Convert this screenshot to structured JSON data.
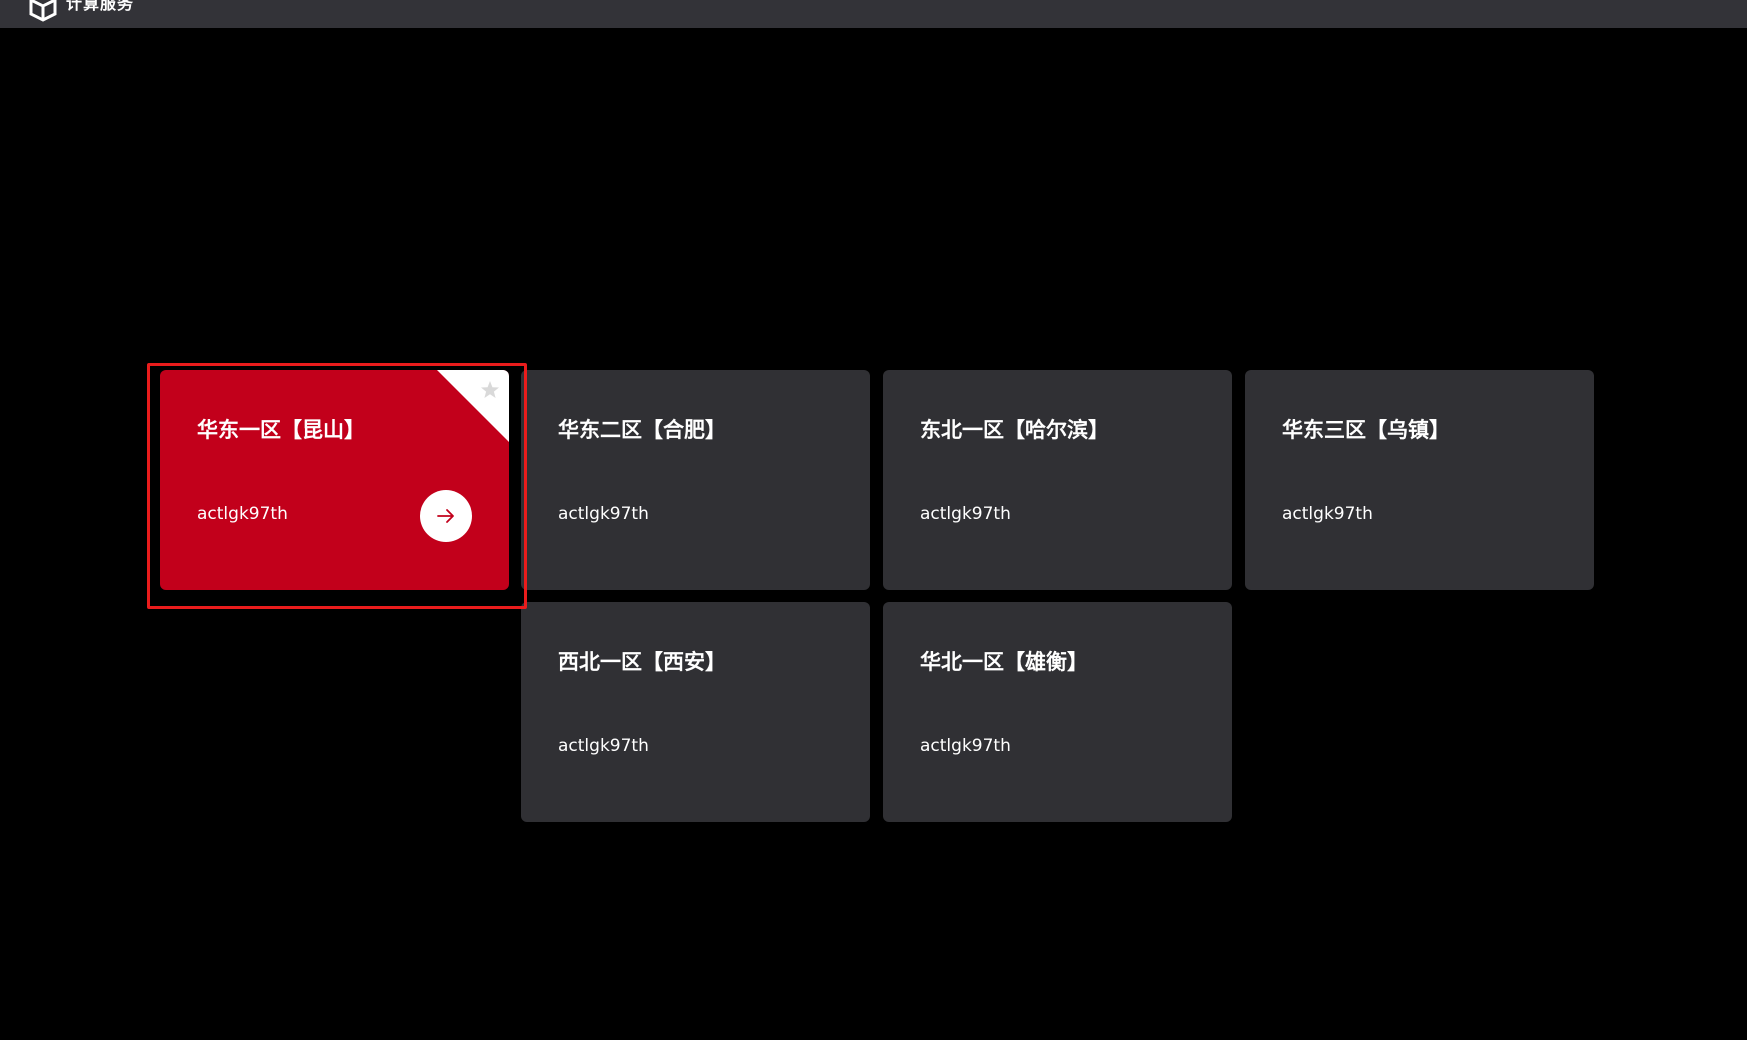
{
  "header": {
    "app_title": "计算服务",
    "logo_icon": "cube-logo-icon"
  },
  "regions": [
    {
      "name": "华东一区【昆山】",
      "account": "actlgk97th",
      "selected": true
    },
    {
      "name": "华东二区【合肥】",
      "account": "actlgk97th",
      "selected": false
    },
    {
      "name": "东北一区【哈尔滨】",
      "account": "actlgk97th",
      "selected": false
    },
    {
      "name": "华东三区【乌镇】",
      "account": "actlgk97th",
      "selected": false
    },
    {
      "name": "西北一区【西安】",
      "account": "actlgk97th",
      "selected": false
    },
    {
      "name": "华北一区【雄衡】",
      "account": "actlgk97th",
      "selected": false
    }
  ],
  "icons": {
    "enter": "arrow-right-icon",
    "favorite": "star-icon"
  },
  "colors": {
    "page_background": "#000000",
    "topbar_background": "#333338",
    "card_background": "#303034",
    "card_selected": "#c2001b",
    "highlight_border": "#ea1c1c"
  }
}
